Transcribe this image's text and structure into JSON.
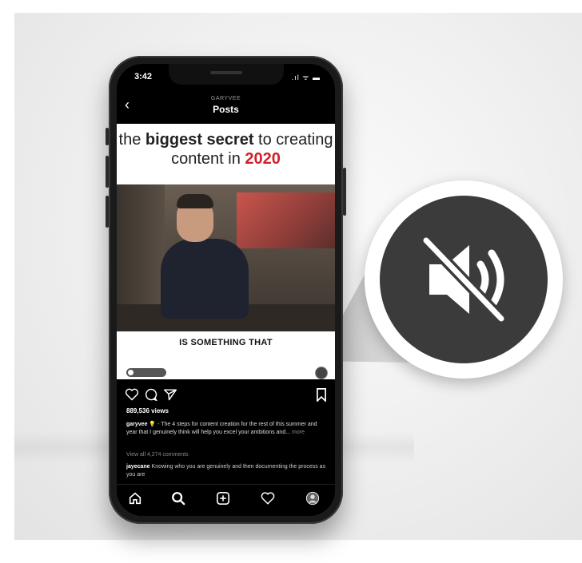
{
  "status_bar": {
    "time": "3:42",
    "icons": ".ıl ᯤ ▬"
  },
  "header": {
    "username": "GARYVEE",
    "title": "Posts",
    "back_icon": "chevron-left-icon"
  },
  "post": {
    "headline_pre": "the ",
    "headline_bold": "biggest secret",
    "headline_mid": " to creating content in ",
    "headline_year": "2020",
    "video_caption": "IS SOMETHING THAT",
    "accent_color": "#d21f2b"
  },
  "actions": {
    "like_icon": "heart-icon",
    "comment_icon": "comment-icon",
    "share_icon": "send-icon",
    "save_icon": "bookmark-icon"
  },
  "views": "889,536 views",
  "caption": {
    "username": "garyvee",
    "text": " 💡 - The 4 steps for content creation for the rest of this summer and year that I genuinely think will help you excel your ambitions and...",
    "more": " more"
  },
  "view_comments": "View all 4,274 comments",
  "comment": {
    "username": "jayecane",
    "text": " Knowing who you are genuinely and then documenting the process as you are"
  },
  "tabbar": [
    "home-icon",
    "search-icon",
    "add-post-icon",
    "activity-heart-icon",
    "profile-avatar-icon"
  ],
  "callout": {
    "icon": "speaker-muted-icon"
  }
}
